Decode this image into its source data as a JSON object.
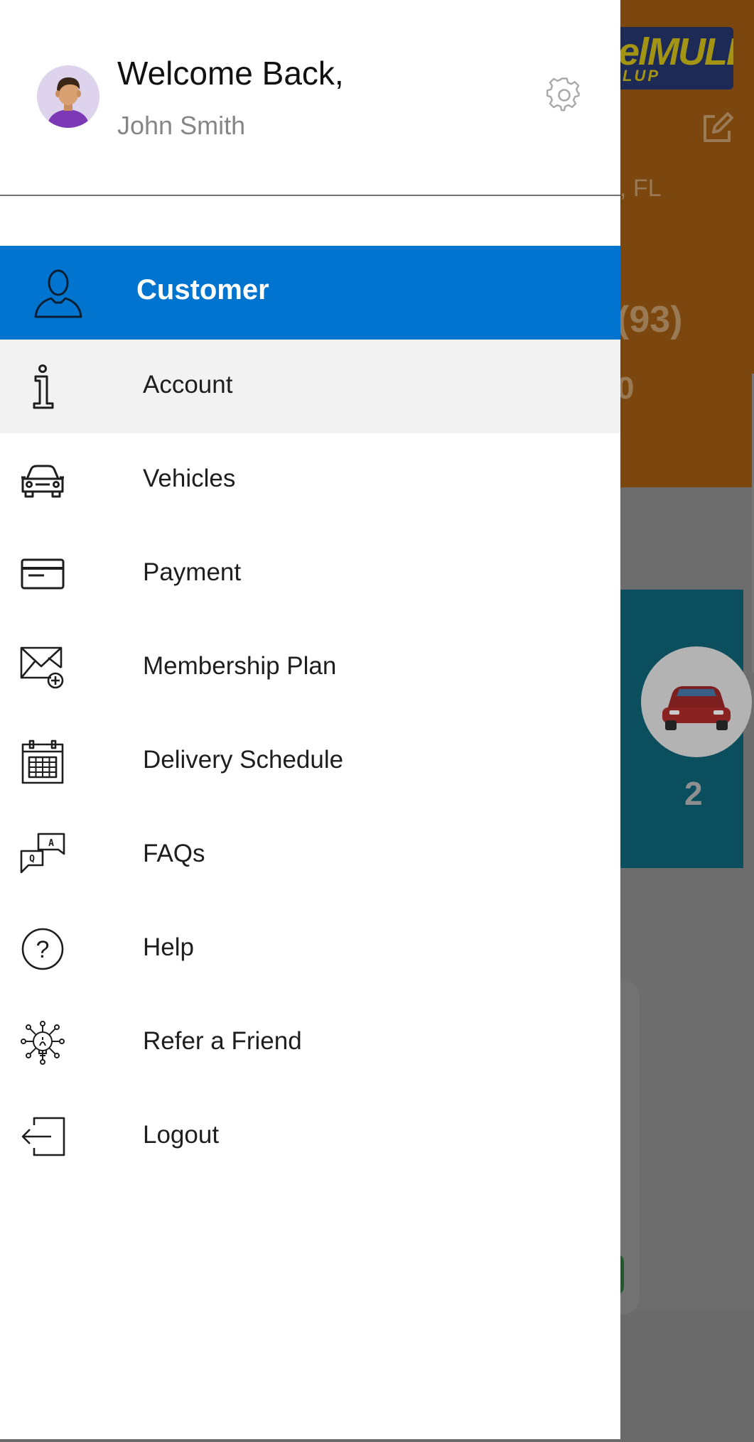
{
  "background": {
    "logo_main": "elMULE",
    "logo_sub": "LUP",
    "location_fragment": ", FL",
    "phone_fragment": "(93)",
    "subtitle_fragment": "0",
    "vehicle_count": "2"
  },
  "drawer": {
    "welcome_text": "Welcome Back,",
    "user_name": "John Smith",
    "section_label": "Customer",
    "items": [
      {
        "label": "Account",
        "icon": "info-icon",
        "active": true
      },
      {
        "label": "Vehicles",
        "icon": "car-icon"
      },
      {
        "label": "Payment",
        "icon": "credit-card-icon"
      },
      {
        "label": "Membership Plan",
        "icon": "mail-plus-icon"
      },
      {
        "label": "Delivery Schedule",
        "icon": "calendar-icon"
      },
      {
        "label": "FAQs",
        "icon": "qa-chat-icon"
      },
      {
        "label": "Help",
        "icon": "question-circle-icon"
      },
      {
        "label": "Refer a Friend",
        "icon": "lightbulb-network-icon"
      },
      {
        "label": "Logout",
        "icon": "logout-icon"
      }
    ]
  },
  "colors": {
    "accent": "#0174d0",
    "active_row": "#f2f2f2",
    "header_bg": "#7b470f",
    "scrim": "#6a6a6a"
  }
}
